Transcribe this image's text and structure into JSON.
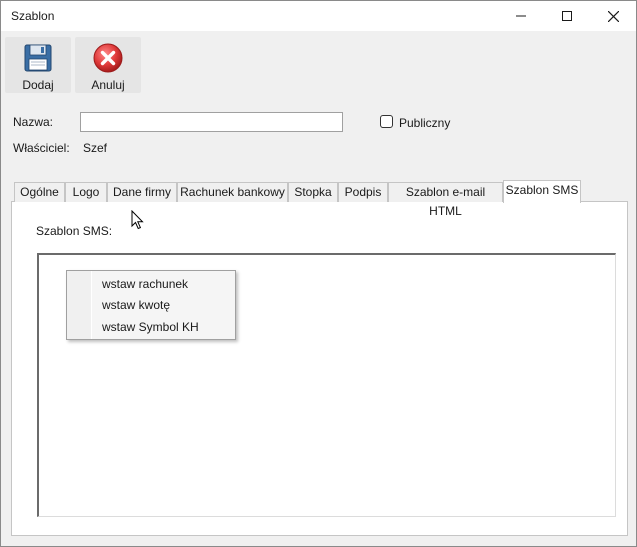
{
  "window": {
    "title": "Szablon"
  },
  "toolbar": {
    "add_label": "Dodaj",
    "cancel_label": "Anuluj"
  },
  "form": {
    "name_label": "Nazwa:",
    "name_value": "",
    "public_label": "Publiczny",
    "public_checked": false,
    "owner_label": "Właściciel:",
    "owner_value": "Szef"
  },
  "tabs": [
    {
      "label": "Ogólne"
    },
    {
      "label": "Logo"
    },
    {
      "label": "Dane firmy"
    },
    {
      "label": "Rachunek bankowy"
    },
    {
      "label": "Stopka"
    },
    {
      "label": "Podpis"
    },
    {
      "label": "Szablon e-mail HTML"
    },
    {
      "label": "Szablon SMS",
      "active": true
    }
  ],
  "sms": {
    "label": "Szablon SMS:",
    "value": ""
  },
  "context_menu": {
    "items": [
      {
        "label": "wstaw rachunek"
      },
      {
        "label": "wstaw kwotę"
      },
      {
        "label": "wstaw Symbol KH"
      }
    ]
  },
  "colors": {
    "save_icon": "#3a6ea5",
    "cancel_icon": "#d93636"
  }
}
